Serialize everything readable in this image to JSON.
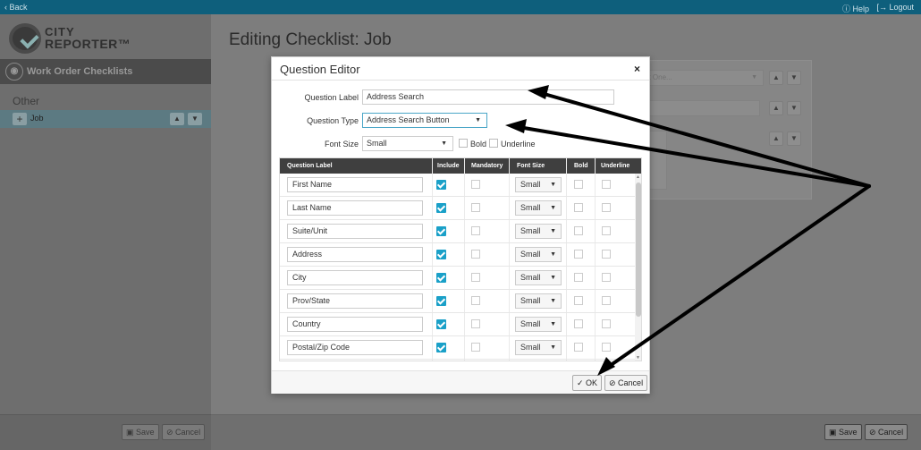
{
  "topbar": {
    "back": "‹ Back",
    "help": "ⓘ Help",
    "logout": "[→ Logout"
  },
  "logo": {
    "line1": "CITY",
    "line2": "REPORTER™"
  },
  "sidebar": {
    "header": "Work Order Checklists",
    "group": "Other",
    "item": "Job",
    "save": "Save",
    "cancel": "Cancel"
  },
  "main": {
    "title": "Editing Checklist: Job",
    "select_placeholder": "ect One...",
    "save": "Save",
    "cancel": "Cancel"
  },
  "modal": {
    "title": "Question Editor",
    "close": "×",
    "question_label_label": "Question Label",
    "question_label_value": "Address Search",
    "question_type_label": "Question Type",
    "question_type_value": "Address Search Button",
    "font_size_label": "Font Size",
    "font_size_value": "Small",
    "bold_label": "Bold",
    "underline_label": "Underline",
    "grid_headers": {
      "question_label": "Question Label",
      "include": "Include",
      "mandatory": "Mandatory",
      "font_size": "Font Size",
      "bold": "Bold",
      "underline": "Underline"
    },
    "rows": [
      {
        "label": "First Name",
        "font_size": "Small",
        "include": true
      },
      {
        "label": "Last Name",
        "font_size": "Small",
        "include": true
      },
      {
        "label": "Suite/Unit",
        "font_size": "Small",
        "include": true
      },
      {
        "label": "Address",
        "font_size": "Small",
        "include": true
      },
      {
        "label": "City",
        "font_size": "Small",
        "include": true
      },
      {
        "label": "Prov/State",
        "font_size": "Small",
        "include": true
      },
      {
        "label": "Country",
        "font_size": "Small",
        "include": true
      },
      {
        "label": "Postal/Zip Code",
        "font_size": "Small",
        "include": true
      }
    ],
    "ok": "OK",
    "cancel": "Cancel"
  },
  "colors": {
    "topbar": "#0e5f7c",
    "accent": "#1aa0c8",
    "arrow": "#000000"
  }
}
